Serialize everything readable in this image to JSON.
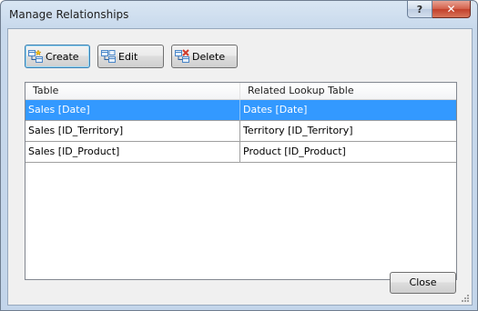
{
  "window": {
    "title": "Manage Relationships",
    "help_glyph": "?",
    "close_glyph": "✕"
  },
  "toolbar": {
    "create_label": "Create",
    "edit_label": "Edit",
    "delete_label": "Delete"
  },
  "grid": {
    "columns": [
      "Table",
      "Related Lookup Table"
    ],
    "rows": [
      {
        "table": "Sales [Date]",
        "lookup": "Dates [Date]",
        "selected": true
      },
      {
        "table": "Sales [ID_Territory]",
        "lookup": "Territory [ID_Territory]",
        "selected": false
      },
      {
        "table": "Sales [ID_Product]",
        "lookup": "Product [ID_Product]",
        "selected": false
      }
    ]
  },
  "footer": {
    "close_label": "Close"
  },
  "colors": {
    "selection": "#3399ff",
    "icon_blue": "#4a86c8",
    "icon_red": "#d03a2a"
  }
}
